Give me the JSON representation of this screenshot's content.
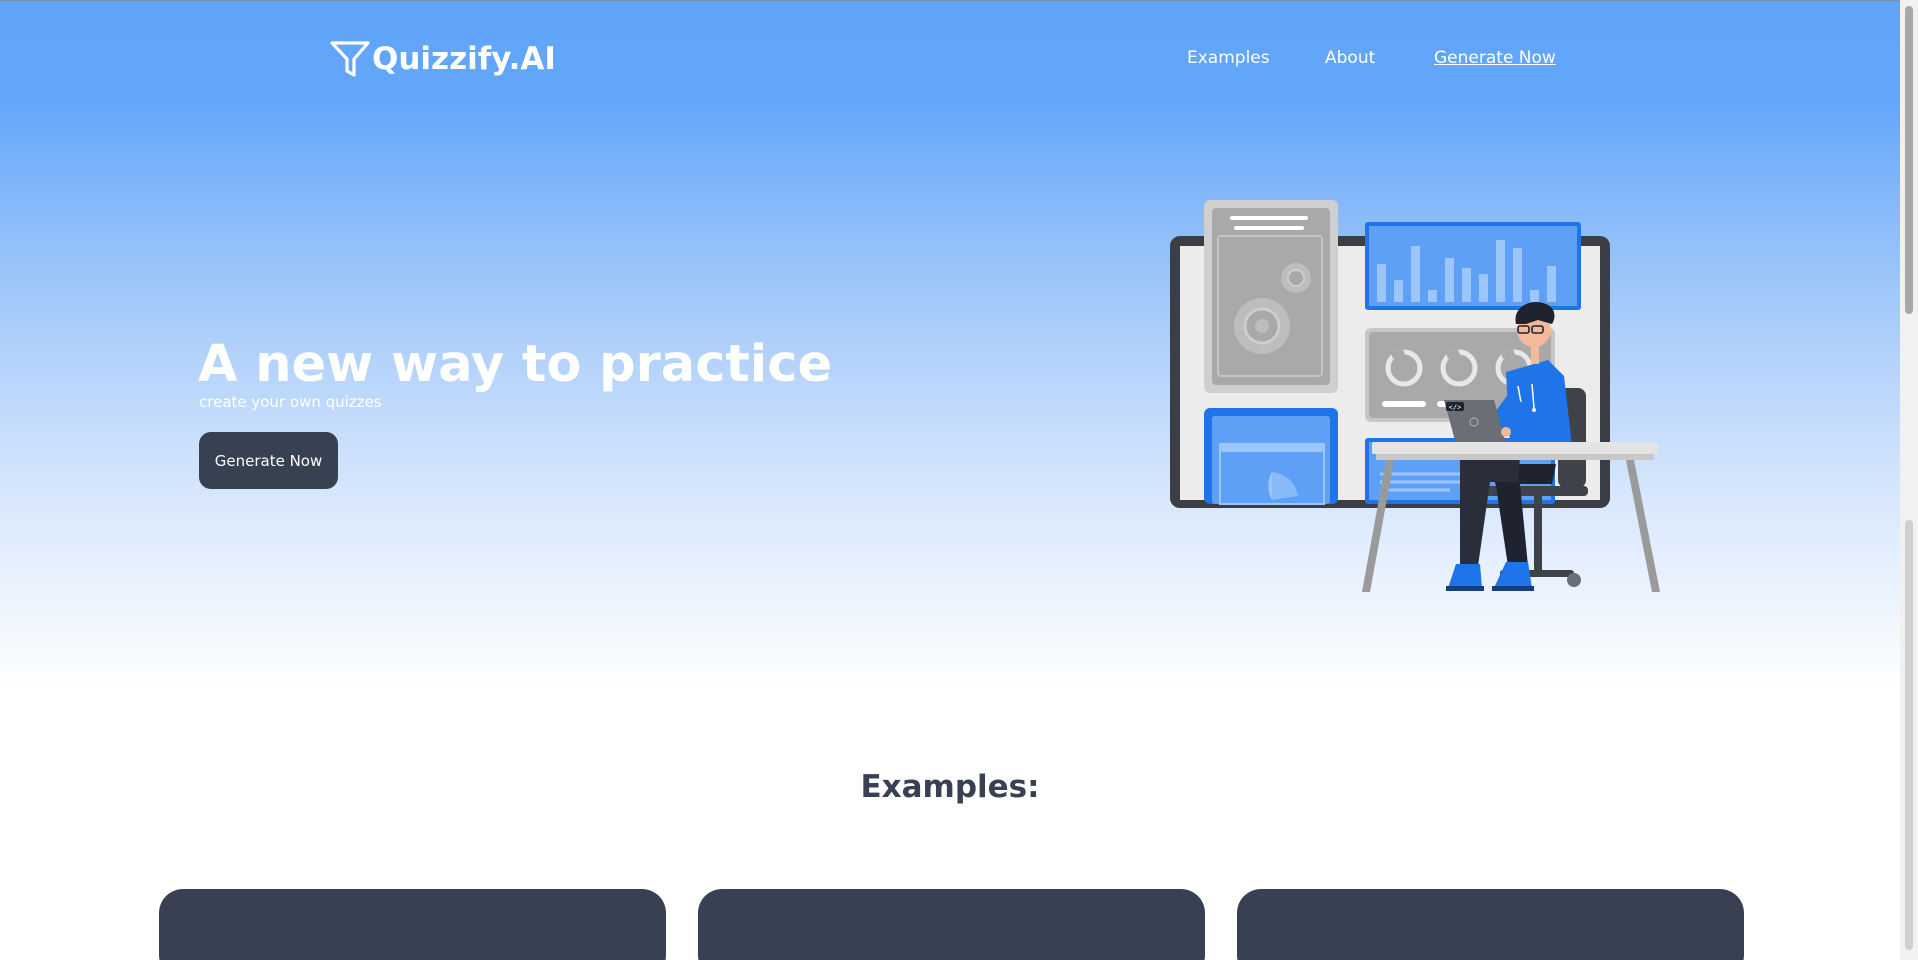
{
  "header": {
    "logo_text": "Quizzify.AI",
    "nav": {
      "examples": "Examples",
      "about": "About",
      "generate": "Generate Now"
    }
  },
  "hero": {
    "title": "A new way to practice",
    "subtitle": "create your own quizzes",
    "cta_label": "Generate Now",
    "illustration_code_tag": "</>"
  },
  "examples": {
    "heading": "Examples:"
  },
  "colors": {
    "hero_gradient_top": "#60a5fa",
    "hero_gradient_bottom": "#ffffff",
    "dark": "#374151",
    "accent_blue": "#1e74e8"
  }
}
